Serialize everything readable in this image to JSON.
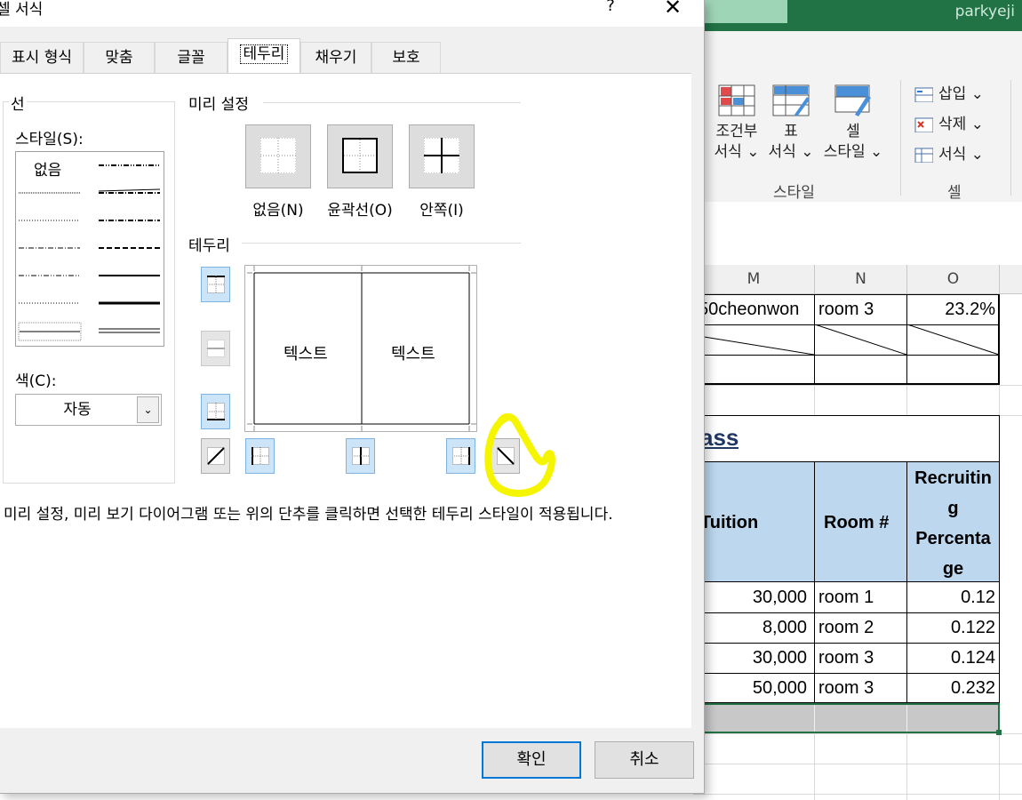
{
  "excel": {
    "user": "parkyeji",
    "ribbon": {
      "cond_format": {
        "line1": "조건부",
        "line2": "서식 ⌄"
      },
      "table_format": {
        "line1": "표",
        "line2": "서식 ⌄"
      },
      "cell_style": {
        "line1": "셀",
        "line2": "스타일 ⌄"
      },
      "style_group": "스타일",
      "insert": "삽입 ⌄",
      "delete": "삭제 ⌄",
      "format": "서식 ⌄",
      "cells_group": "셀"
    },
    "columns": [
      "M",
      "N",
      "O"
    ],
    "row1": [
      "50cheonwon",
      "room 3",
      "23.2%"
    ],
    "heading_fragment": "ass",
    "table_headers": [
      "Tuition",
      "Room #",
      "Recruitin",
      "g",
      "Percenta",
      "ge"
    ],
    "rows": [
      [
        "30,000",
        "room 1",
        "0.12"
      ],
      [
        "8,000",
        "room 2",
        "0.122"
      ],
      [
        "30,000",
        "room 3",
        "0.124"
      ],
      [
        "50,000",
        "room 3",
        "0.232"
      ]
    ],
    "colors": {
      "title_green": "#217346",
      "header_fill": "#bdd7ee",
      "total_fill": "#c8c8c8",
      "heading_text": "#1f3864"
    }
  },
  "dialog": {
    "title": "셀 서식",
    "help": "?",
    "close": "✕",
    "tabs": [
      "표시 형식",
      "맞춤",
      "글꼴",
      "테두리",
      "채우기",
      "보호"
    ],
    "active_tab": "테두리",
    "line_group": "선",
    "style_label": "스타일(S):",
    "style_none": "없음",
    "color_label": "색(C):",
    "color_value": "자동",
    "presets_label": "미리 설정",
    "presets": [
      "없음(N)",
      "윤곽선(O)",
      "안쪽(I)"
    ],
    "border_label": "테두리",
    "preview_text": [
      "텍스트",
      "텍스트"
    ],
    "description": "미리 설정, 미리 보기 다이어그램 또는 위의 단추를 클릭하면 선택한 테두리 스타일이 적용됩니다.",
    "ok": "확인",
    "cancel": "취소",
    "highlight_color": "#f5f500"
  }
}
